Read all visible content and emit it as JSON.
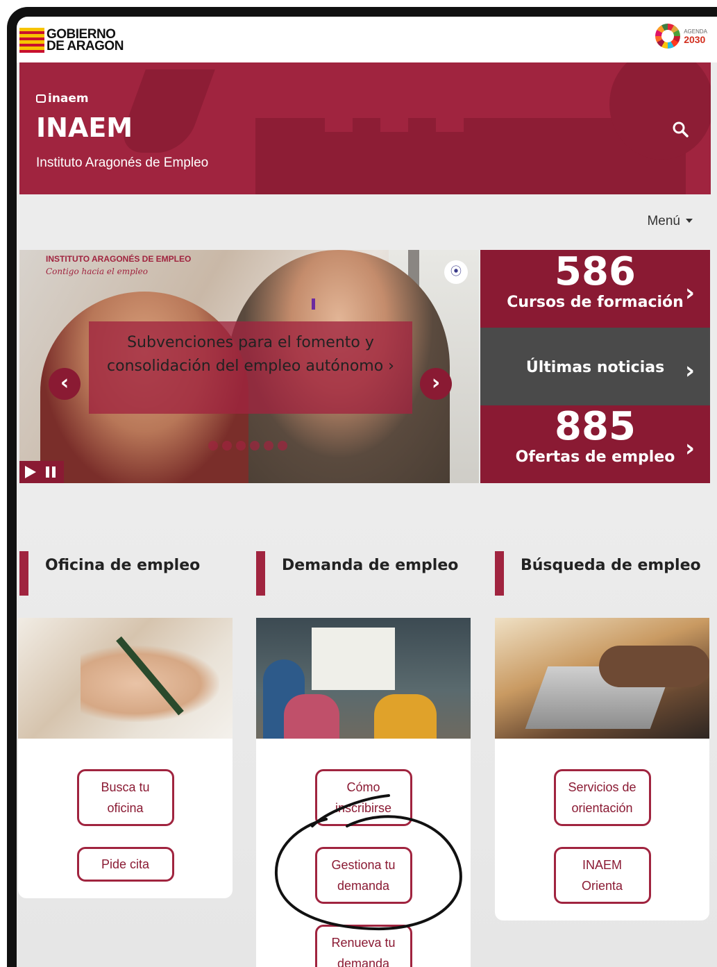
{
  "header": {
    "gov_logo_line1": "GOBIERNO",
    "gov_logo_line2": "DE ARAGON",
    "agenda_label": "AGENDA",
    "agenda_year": "2030"
  },
  "banner": {
    "small_logo": "inaem",
    "title": "INAEM",
    "subtitle": "Instituto Aragonés de Empleo",
    "search_icon": "search-icon"
  },
  "nav": {
    "menu_label": "Menú"
  },
  "carousel": {
    "brand": "INSTITUTO ARAGONÉS DE EMPLEO",
    "tagline": "Contigo hacia el empleo",
    "caption": "Subvenciones para el fomento y consolidación del empleo autónomo ›",
    "prev_icon": "‹",
    "next_icon": "›",
    "slide_count": 6
  },
  "stats": {
    "cursos_number": "586",
    "cursos_label": "Cursos de formación",
    "noticias_label": "Últimas noticias",
    "ofertas_number": "885",
    "ofertas_label": "Ofertas de empleo",
    "arrow": "›"
  },
  "sections": [
    {
      "title": "Oficina de empleo",
      "buttons": [
        "Busca tu oficina",
        "Pide cita"
      ]
    },
    {
      "title": "Demanda de empleo",
      "buttons": [
        "Cómo inscribirse",
        "Gestiona tu demanda",
        "Renueva tu demanda"
      ]
    },
    {
      "title": "Búsqueda de empleo",
      "buttons": [
        "Servicios de orientación",
        "INAEM Orienta"
      ]
    }
  ],
  "colors": {
    "brand": "#a0243f",
    "brand_dark": "#8a1a33",
    "news_bg": "#4a4a4a"
  }
}
